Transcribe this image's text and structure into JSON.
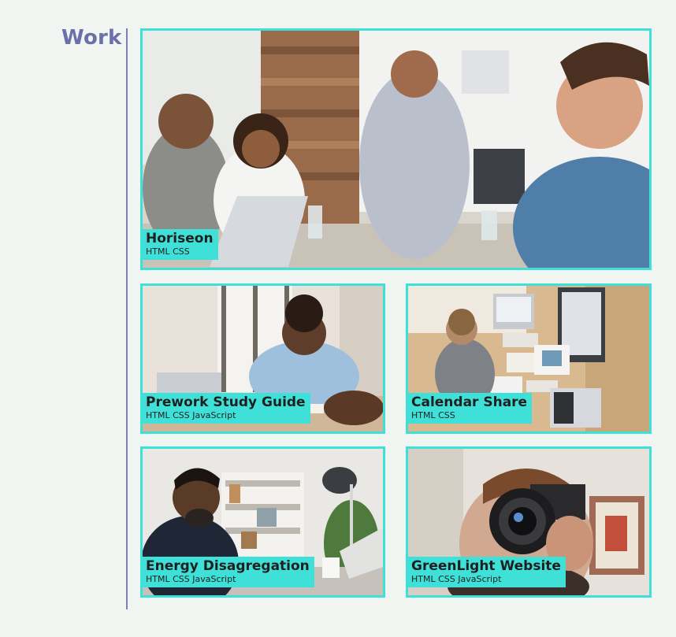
{
  "work": {
    "title": "Work",
    "projects": [
      {
        "name": "Horiseon",
        "tech": "HTML CSS"
      },
      {
        "name": "Prework Study Guide",
        "tech": "HTML CSS JavaScript"
      },
      {
        "name": "Calendar Share",
        "tech": "HTML CSS"
      },
      {
        "name": "Energy Disagregation",
        "tech": "HTML CSS JavaScript"
      },
      {
        "name": "GreenLight Website",
        "tech": "HTML CSS JavaScript"
      }
    ]
  },
  "colors": {
    "accent": "#3fe0d8",
    "title": "#6b71a8",
    "divider": "#7d80b4",
    "background": "#f0f5f1"
  }
}
